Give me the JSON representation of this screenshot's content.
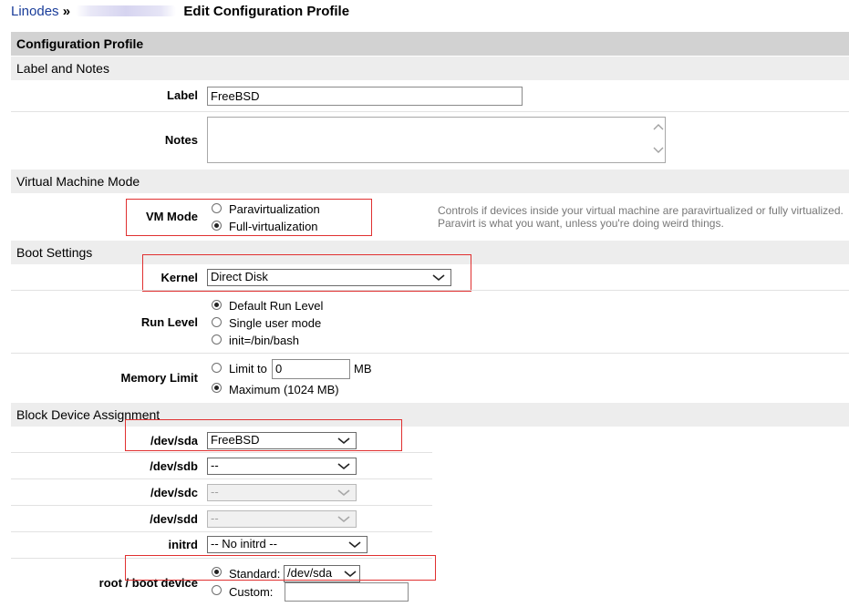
{
  "breadcrumb": {
    "root": "Linodes",
    "sep": "»",
    "current": "Edit Configuration Profile"
  },
  "header": {
    "title": "Configuration Profile"
  },
  "sections": {
    "label_notes": "Label and Notes",
    "vm_mode": "Virtual Machine Mode",
    "boot": "Boot Settings",
    "block": "Block Device Assignment"
  },
  "fields": {
    "label": {
      "label": "Label",
      "value": "FreeBSD"
    },
    "notes": {
      "label": "Notes",
      "value": ""
    },
    "vm_mode": {
      "label": "VM Mode",
      "options": [
        "Paravirtualization",
        "Full-virtualization"
      ],
      "selected": "Full-virtualization",
      "help_line1": "Controls if devices inside your virtual machine are paravirtualized or fully virtualized.",
      "help_line2": "Paravirt is what you want, unless you're doing weird things."
    },
    "kernel": {
      "label": "Kernel",
      "value": "Direct Disk"
    },
    "run_level": {
      "label": "Run Level",
      "options": [
        "Default Run Level",
        "Single user mode",
        "init=/bin/bash"
      ],
      "selected": "Default Run Level"
    },
    "memory_limit": {
      "label": "Memory Limit",
      "limit_label": "Limit to",
      "limit_value": "0",
      "unit": "MB",
      "max_label": "Maximum (1024 MB)",
      "selected": "Maximum (1024 MB)"
    },
    "sda": {
      "label": "/dev/sda",
      "value": "FreeBSD"
    },
    "sdb": {
      "label": "/dev/sdb",
      "value": "--"
    },
    "sdc": {
      "label": "/dev/sdc",
      "value": "--",
      "disabled": true
    },
    "sdd": {
      "label": "/dev/sdd",
      "value": "--",
      "disabled": true
    },
    "initrd": {
      "label": "initrd",
      "value": "-- No initrd --"
    },
    "root_device": {
      "label": "root / boot device",
      "standard_label": "Standard:",
      "standard_value": "/dev/sda",
      "custom_label": "Custom:",
      "custom_value": "",
      "selected": "Standard:"
    }
  }
}
